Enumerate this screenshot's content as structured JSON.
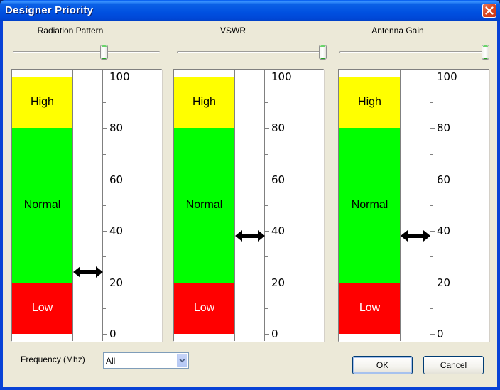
{
  "window": {
    "title": "Designer Priority",
    "close_icon": "close-x-icon"
  },
  "colors": {
    "high_zone": "#FFFF00",
    "normal_zone": "#00FF00",
    "low_zone": "#FF0000",
    "titlebar": "#0050E0"
  },
  "panels": [
    {
      "label": "Radiation Pattern",
      "slider_percent": 62,
      "gauge_value": 24,
      "zones": [
        {
          "label": "High",
          "from": 80,
          "to": 100
        },
        {
          "label": "Normal",
          "from": 20,
          "to": 80
        },
        {
          "label": "Low",
          "from": 0,
          "to": 20
        }
      ]
    },
    {
      "label": "VSWR",
      "slider_percent": 100,
      "gauge_value": 38,
      "zones": [
        {
          "label": "High",
          "from": 80,
          "to": 100
        },
        {
          "label": "Normal",
          "from": 20,
          "to": 80
        },
        {
          "label": "Low",
          "from": 0,
          "to": 20
        }
      ]
    },
    {
      "label": "Antenna Gain",
      "slider_percent": 100,
      "gauge_value": 38,
      "zones": [
        {
          "label": "High",
          "from": 80,
          "to": 100
        },
        {
          "label": "Normal",
          "from": 20,
          "to": 80
        },
        {
          "label": "Low",
          "from": 0,
          "to": 20
        }
      ]
    }
  ],
  "scale": {
    "min": 0,
    "max": 100,
    "major_ticks": [
      0,
      20,
      40,
      60,
      80,
      100
    ],
    "minor_ticks": [
      10,
      30,
      50,
      70,
      90
    ],
    "tick_labels": [
      "100",
      "80",
      "60",
      "40",
      "20",
      "0"
    ]
  },
  "frequency": {
    "label": "Frequency (Mhz)",
    "selected": "All",
    "dropdown_icon": "chevron-down-icon"
  },
  "buttons": {
    "ok": "OK",
    "cancel": "Cancel"
  }
}
